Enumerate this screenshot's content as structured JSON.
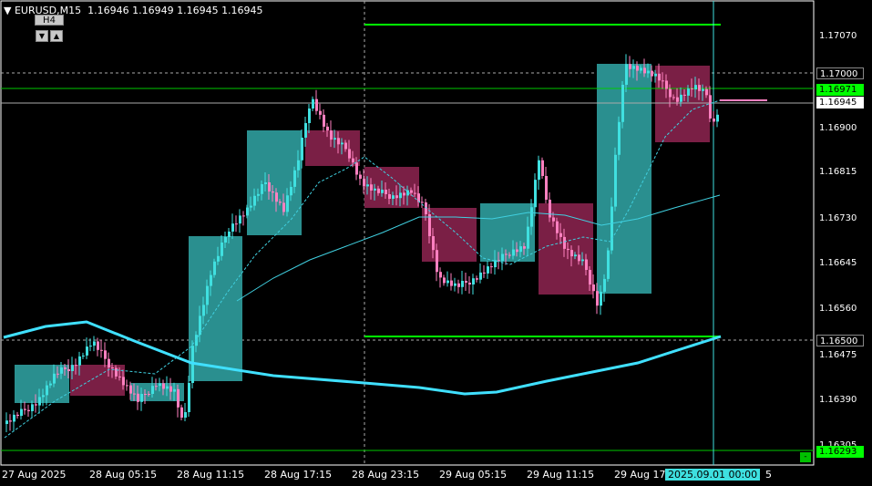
{
  "header": {
    "symbol": "EURUSD,M15",
    "ohlc": "1.16946 1.16949 1.16945 1.16945",
    "timeframe_button": "H4"
  },
  "price_axis": [
    "1.17070",
    "1.16900",
    "1.16815",
    "1.16730",
    "1.16645",
    "1.16560",
    "1.16475",
    "1.16390",
    "1.16305"
  ],
  "price_markers": {
    "grid_level_1": "1.17000",
    "green_line": "1.16971",
    "bid": "1.16945",
    "grid_level_2": "1.16500",
    "lower_level": "1.16293"
  },
  "time_axis": [
    "27 Aug 2025",
    "28 Aug 05:15",
    "28 Aug 11:15",
    "28 Aug 17:15",
    "28 Aug 23:15",
    "29 Aug 05:15",
    "29 Aug 11:15",
    "29 Aug 17",
    "5"
  ],
  "cursor_time": "2025.09.01 00:00",
  "colors": {
    "bull": "#40e0e0",
    "bear": "#ff80c0",
    "h4_bull": "#2a8f8f",
    "h4_bear": "#7a1f45",
    "ma_thick": "#40e0ff",
    "ma_thin": "#40d0e0",
    "green": "#00ff00"
  }
}
